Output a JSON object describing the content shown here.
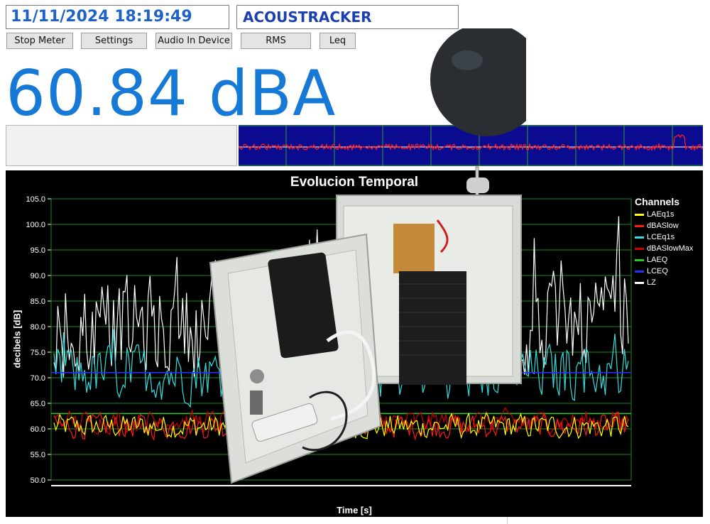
{
  "header": {
    "datetime": "11/11/2024 18:19:49",
    "app_title": "ACOUSTRACKER"
  },
  "toolbar": {
    "buttons": [
      "Stop Meter",
      "Settings",
      "Audio In Device",
      "RMS",
      "Leq"
    ]
  },
  "meter": {
    "reading": "60.84 dBA",
    "level_fraction": 0
  },
  "colors": {
    "reading": "#1679d6",
    "trend_background": "#0b0b8f",
    "chart_background": "#000000",
    "grid": "#1f8a1f"
  },
  "chart_data": {
    "type": "line",
    "title": "Evolucion Temporal",
    "xlabel": "Time [s]",
    "ylabel": "decibels [dB]",
    "ylim": [
      50,
      105
    ],
    "yticks": [
      "105.0",
      "100.0",
      "95.0",
      "90.0",
      "85.0",
      "80.0",
      "75.0",
      "70.0",
      "65.0",
      "60.0",
      "55.0",
      "50.0"
    ],
    "grid": true,
    "legend_position": "right",
    "legend_title": "Channels",
    "series": [
      {
        "name": "LAEq1s",
        "color": "#ffff00",
        "base": 60.5,
        "amp": 2.2,
        "values": []
      },
      {
        "name": "dBASlow",
        "color": "#ff1a1a",
        "base": 60.5,
        "amp": 2.2,
        "values": []
      },
      {
        "name": "LCEq1s",
        "color": "#33dede",
        "base": 71,
        "amp": 5,
        "values": []
      },
      {
        "name": "dBASlowMax",
        "color": "#cc0000",
        "base": 61.5,
        "amp": 2,
        "values": []
      },
      {
        "name": "LAEQ",
        "color": "#22cc22",
        "values": [
          63
        ]
      },
      {
        "name": "LCEQ",
        "color": "#2233ff",
        "values": [
          71
        ]
      },
      {
        "name": "LZ",
        "color": "#ffffff",
        "base": 80,
        "amp": 9,
        "values": []
      }
    ]
  }
}
